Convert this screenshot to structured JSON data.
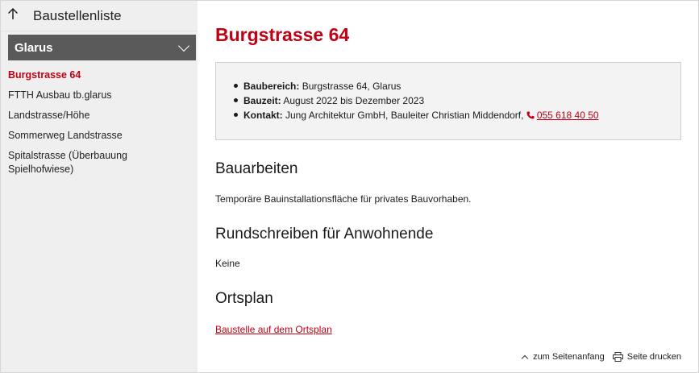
{
  "sidebar": {
    "back_label": "Baustellenliste",
    "section_title": "Glarus",
    "items": [
      {
        "label": "Burgstrasse 64",
        "active": true
      },
      {
        "label": "FTTH Ausbau tb.glarus",
        "active": false
      },
      {
        "label": "Landstrasse/Höhe",
        "active": false
      },
      {
        "label": "Sommerweg Landstrasse",
        "active": false
      },
      {
        "label": "Spitalstrasse (Überbauung Spielhofwiese)",
        "active": false
      }
    ]
  },
  "main": {
    "title": "Burgstrasse 64",
    "info": {
      "baubereich_label": "Baubereich:",
      "baubereich_value": " Burgstrasse 64, Glarus",
      "bauzeit_label": "Bauzeit:",
      "bauzeit_value": " August 2022 bis Dezember 2023",
      "kontakt_label": "Kontakt:",
      "kontakt_value": " Jung Architektur GmbH, Bauleiter Christian Middendorf, ",
      "phone": "055 618 40 50"
    },
    "bauarbeiten_heading": "Bauarbeiten",
    "bauarbeiten_text": "Temporäre Bauinstallationsfläche für privates Bauvorhaben.",
    "rundschreiben_heading": "Rundschreiben für Anwohnende",
    "rundschreiben_text": "Keine",
    "ortsplan_heading": "Ortsplan",
    "ortsplan_link": "Baustelle auf dem Ortsplan"
  },
  "footer": {
    "top_label": "zum Seitenanfang",
    "print_label": "Seite drucken"
  },
  "colors": {
    "accent": "#c00014",
    "sidebar_bg": "#efefef",
    "section_header_bg": "#5a5a5a",
    "infobox_bg": "#f3f3f3"
  },
  "icons": [
    "arrow-up-icon",
    "chevron-down-icon",
    "phone-icon",
    "caret-up-icon",
    "printer-icon"
  ]
}
